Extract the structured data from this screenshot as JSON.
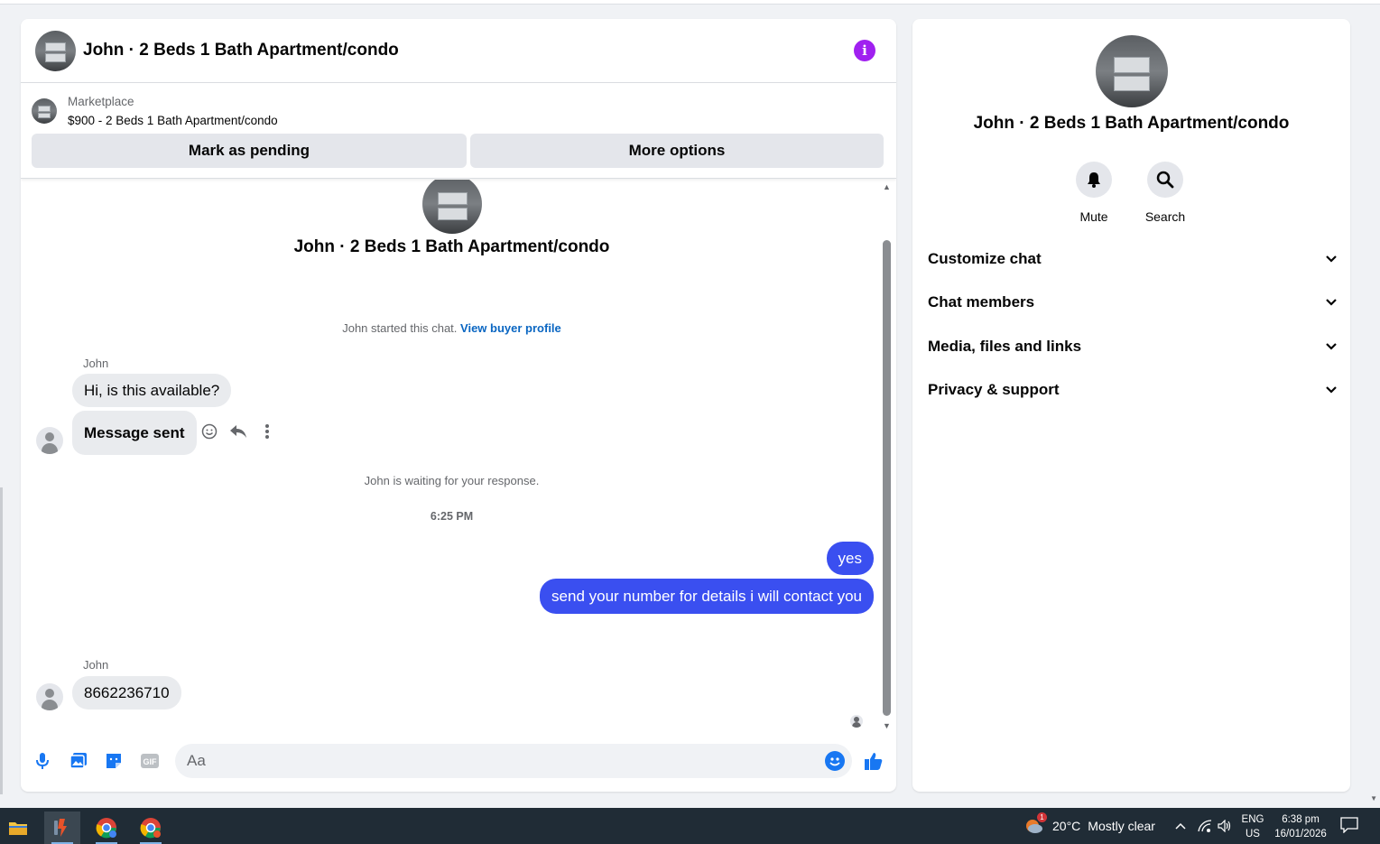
{
  "chat": {
    "header_title": "John · 2 Beds 1 Bath Apartment/condo",
    "info_icon": "i",
    "marketplace_label": "Marketplace",
    "listing": "$900 - 2 Beds 1 Bath Apartment/condo",
    "mark_pending": "Mark as pending",
    "more_options": "More options",
    "conversation_title": "John · 2 Beds 1 Bath Apartment/condo",
    "started_text": "John started this chat.",
    "view_buyer_profile": "View buyer profile",
    "waiting_text": "John is waiting for your response.",
    "timestamp": "6:25 PM",
    "messages": [
      {
        "sender": "John",
        "text": "Hi, is this available?"
      },
      {
        "sender": "",
        "text": "Message sent"
      },
      {
        "sender": "me",
        "text": "yes"
      },
      {
        "sender": "me",
        "text": "send your number for details i will contact you"
      },
      {
        "sender": "John",
        "text": "8662236710"
      }
    ],
    "sender_name_1": "John",
    "sender_name_2": "John",
    "composer_placeholder": "Aa",
    "composer_icons": [
      "microphone-icon",
      "photo-icon",
      "sticker-icon",
      "gif-icon",
      "emoji-icon",
      "like-icon"
    ],
    "gif_label": "GIF"
  },
  "info": {
    "title": "John · 2 Beds 1 Bath Apartment/condo",
    "mute_label": "Mute",
    "search_label": "Search",
    "sections": [
      "Customize chat",
      "Chat members",
      "Media, files and links",
      "Privacy & support"
    ]
  },
  "taskbar": {
    "apps": [
      "file-explorer-icon",
      "app-icon",
      "chrome-icon",
      "chrome-icon"
    ],
    "weather_badge": "1",
    "temperature": "20°C",
    "weather": "Mostly clear",
    "lang_top": "ENG",
    "lang_bottom": "US",
    "time": "6:38 pm",
    "date": "16/01/2026"
  },
  "colors": {
    "accent": "#3a4ff0",
    "link": "#0a66c2",
    "info_purple": "#a020f0",
    "taskbar": "#202c36"
  }
}
